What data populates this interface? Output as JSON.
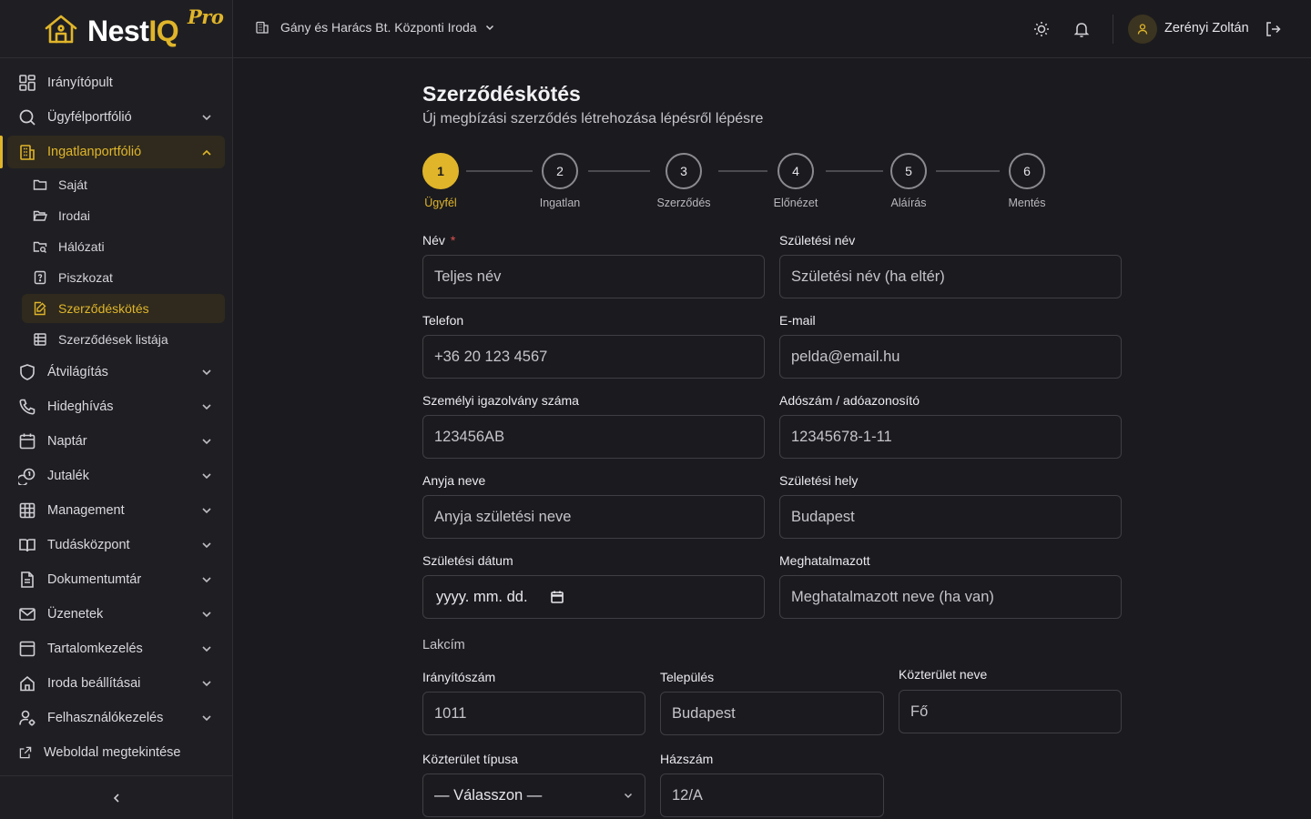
{
  "brand": {
    "name_main": "Nest",
    "name_accent": "IQ",
    "edition": "Pro"
  },
  "header": {
    "office": "Gány és Harács Bt. Központi Iroda",
    "username": "Zerényi Zoltán"
  },
  "sidebar": {
    "items": [
      {
        "label": "Irányítópult"
      },
      {
        "label": "Ügyfélportfólió"
      },
      {
        "label": "Ingatlanportfólió"
      },
      {
        "label": "Átvilágítás"
      },
      {
        "label": "Hideghívás"
      },
      {
        "label": "Naptár"
      },
      {
        "label": "Jutalék"
      },
      {
        "label": "Management"
      },
      {
        "label": "Tudásközpont"
      },
      {
        "label": "Dokumentumtár"
      },
      {
        "label": "Üzenetek"
      },
      {
        "label": "Tartalomkezelés"
      },
      {
        "label": "Iroda beállításai"
      },
      {
        "label": "Felhasználókezelés"
      },
      {
        "label": "Weboldal megtekintése"
      }
    ],
    "subitems": [
      {
        "label": "Saját"
      },
      {
        "label": "Irodai"
      },
      {
        "label": "Hálózati"
      },
      {
        "label": "Piszkozat"
      },
      {
        "label": "Szerződéskötés"
      },
      {
        "label": "Szerződések listája"
      }
    ]
  },
  "page": {
    "title": "Szerződéskötés",
    "subtitle": "Új megbízási szerződés létrehozása lépésről lépésre"
  },
  "steps": [
    {
      "num": "1",
      "label": "Ügyfél"
    },
    {
      "num": "2",
      "label": "Ingatlan"
    },
    {
      "num": "3",
      "label": "Szerződés"
    },
    {
      "num": "4",
      "label": "Előnézet"
    },
    {
      "num": "5",
      "label": "Aláírás"
    },
    {
      "num": "6",
      "label": "Mentés"
    }
  ],
  "form": {
    "name": {
      "label": "Név",
      "required": "*",
      "placeholder": "Teljes név"
    },
    "birth_name": {
      "label": "Születési név",
      "placeholder": "Születési név (ha eltér)"
    },
    "phone": {
      "label": "Telefon",
      "placeholder": "+36 20 123 4567"
    },
    "email": {
      "label": "E-mail",
      "placeholder": "pelda@email.hu"
    },
    "id_number": {
      "label": "Személyi igazolvány száma",
      "placeholder": "123456AB"
    },
    "tax_id": {
      "label": "Adószám / adóazonosító",
      "placeholder": "12345678-1-11"
    },
    "mother_name": {
      "label": "Anyja neve",
      "placeholder": "Anyja születési neve"
    },
    "birth_place": {
      "label": "Születési hely",
      "placeholder": "Budapest"
    },
    "birth_date": {
      "label": "Születési dátum",
      "placeholder": "yyyy. mm. dd."
    },
    "proxy": {
      "label": "Meghatalmazott",
      "placeholder": "Meghatalmazott neve (ha van)"
    },
    "address_section": "Lakcím",
    "zip": {
      "label": "Irányítószám",
      "placeholder": "1011"
    },
    "city": {
      "label": "Település",
      "placeholder": "Budapest"
    },
    "street_name": {
      "label": "Közterület neve",
      "placeholder": "Fő"
    },
    "street_type": {
      "label": "Közterület típusa",
      "value": "— Válasszon —"
    },
    "house_number": {
      "label": "Házszám",
      "placeholder": "12/A"
    }
  },
  "colors": {
    "accent": "#e0b52a",
    "background": "#1b1b1f",
    "sidebar": "#1f1f23",
    "required": "#e05050"
  }
}
